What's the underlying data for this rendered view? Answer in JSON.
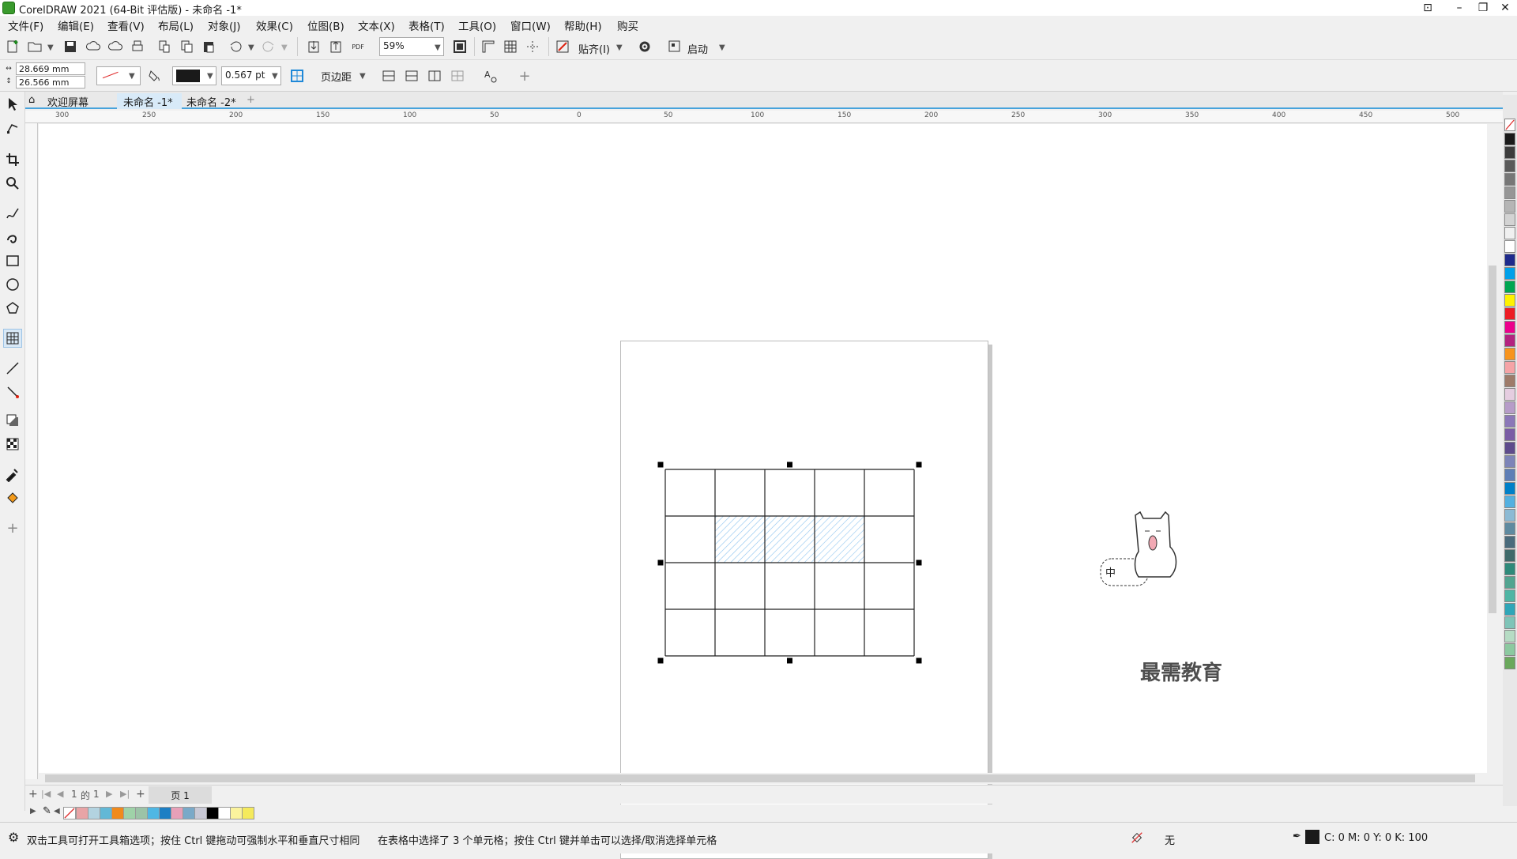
{
  "window": {
    "title": "CorelDRAW 2021 (64-Bit 评估版) - 未命名 -1*"
  },
  "menu": [
    "文件(F)",
    "编辑(E)",
    "查看(V)",
    "布局(L)",
    "对象(J)",
    "效果(C)",
    "位图(B)",
    "文本(X)",
    "表格(T)",
    "工具(O)",
    "窗口(W)",
    "帮助(H)",
    "购买"
  ],
  "toolbar": {
    "zoom": "59%",
    "snap_label": "贴齐(I)",
    "launch_label": "启动"
  },
  "property_bar": {
    "width": "28.669 mm",
    "height": "26.566 mm",
    "outline_width": "0.567 pt",
    "margins_label": "页边距"
  },
  "tabs": [
    {
      "label": "欢迎屏幕",
      "active": false
    },
    {
      "label": "未命名 -1*",
      "active": true
    },
    {
      "label": "未命名 -2*",
      "active": false
    }
  ],
  "ruler": {
    "h_labels": [
      "300",
      "250",
      "200",
      "150",
      "100",
      "50",
      "0",
      "50",
      "100",
      "150",
      "200",
      "250",
      "300",
      "350",
      "400",
      "450",
      "500"
    ],
    "unit": "毫米"
  },
  "table": {
    "rows": 4,
    "cols": 5,
    "selected_row": 1,
    "selected_cols": [
      1,
      2,
      3
    ]
  },
  "page_nav": {
    "current": "1",
    "of_label": "的",
    "total": "1",
    "page_tab": "页 1"
  },
  "palette_colors": [
    "#e8a4a6",
    "#b3d3e0",
    "#62b8d6",
    "#f08a1c",
    "#9fd2a8",
    "#9cc3a7",
    "#4fb7e4",
    "#1d7fc4",
    "#e7a0b8",
    "#7aa9c8",
    "#c9c9d6",
    "#000000",
    "#ffffff",
    "#fbf39d",
    "#f5ea5c"
  ],
  "right_palette_colors": [
    "#1a1a1a",
    "#3c3c3c",
    "#5a5a5a",
    "#777777",
    "#969696",
    "#b5b5b5",
    "#d3d3d3",
    "#f0f0f0",
    "#ffffff",
    "#1e2a8c",
    "#00a0e9",
    "#00a651",
    "#fff200",
    "#ed1c24",
    "#ec008c",
    "#b3237f",
    "#f7941d",
    "#f5a3a6",
    "#9e7b6a",
    "#e5cde0",
    "#b69cc8",
    "#8b77b8",
    "#7a5ca5",
    "#5e4b8c",
    "#7d84b8",
    "#5e7eb6",
    "#0080c8",
    "#54b0e0",
    "#8cbad4",
    "#5e8aa0",
    "#4a6b7c",
    "#3f6a6a",
    "#2e8a7a",
    "#52a490",
    "#4fb5a4",
    "#2fa6b8",
    "#7fc4b8",
    "#b6dcc4",
    "#8cc9a0",
    "#6aa85c"
  ],
  "status": {
    "hint_left": "双击工具可打开工具箱选项；按住 Ctrl 键拖动可强制水平和垂直尺寸相同",
    "hint_center": "在表格中选择了 3 个单元格；按住 Ctrl 键并单击可以选择/取消选择单元格",
    "fill_label": "无",
    "cmyk": "C: 0 M: 0 Y: 0 K: 100"
  },
  "watermark": "最需教育",
  "colors": {
    "accent": "#47a3dc",
    "selection": "#1e88d8"
  }
}
